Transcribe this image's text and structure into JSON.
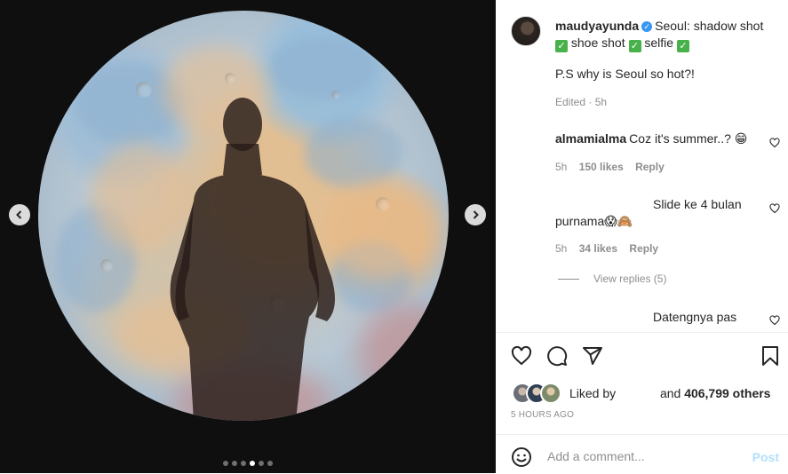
{
  "post": {
    "username": "maudyayunda",
    "verified_mark": "✓",
    "caption_1": "Seoul: shadow shot",
    "caption_2": "shoe shot",
    "caption_3": "selfie",
    "check_mark": "✓",
    "ps": "P.S why is Seoul so hot?!",
    "meta": "Edited · 5h"
  },
  "comments": [
    {
      "username": "almamialma",
      "text": "Coz it's summer..? 😁",
      "time": "5h",
      "likes": "150 likes",
      "reply": "Reply"
    },
    {
      "username": "",
      "text_line1": "Slide ke 4 bulan",
      "text_line2": "purnama😱🙈",
      "time": "5h",
      "likes": "34 likes",
      "reply": "Reply"
    },
    {
      "username": "",
      "text": "Datengnya pas"
    }
  ],
  "view_replies": "View replies (5)",
  "likes": {
    "liked_by": "Liked by",
    "and": "and",
    "count": "406,799 others"
  },
  "time_ago": "5 HOURS AGO",
  "comment_box": {
    "placeholder": "Add a comment...",
    "post_label": "Post"
  },
  "carousel": {
    "total": 6,
    "active": 4
  },
  "icons": {
    "prev": "chevron-left-icon",
    "next": "chevron-right-icon",
    "like": "heart-icon",
    "comment": "comment-icon",
    "share": "share-icon",
    "save": "bookmark-icon",
    "emoji": "smiley-icon"
  },
  "colors": {
    "verified": "#3897f0",
    "check": "#48b14a",
    "post_disabled": "#b2dffc",
    "secondary_text": "#8e8e8e"
  }
}
